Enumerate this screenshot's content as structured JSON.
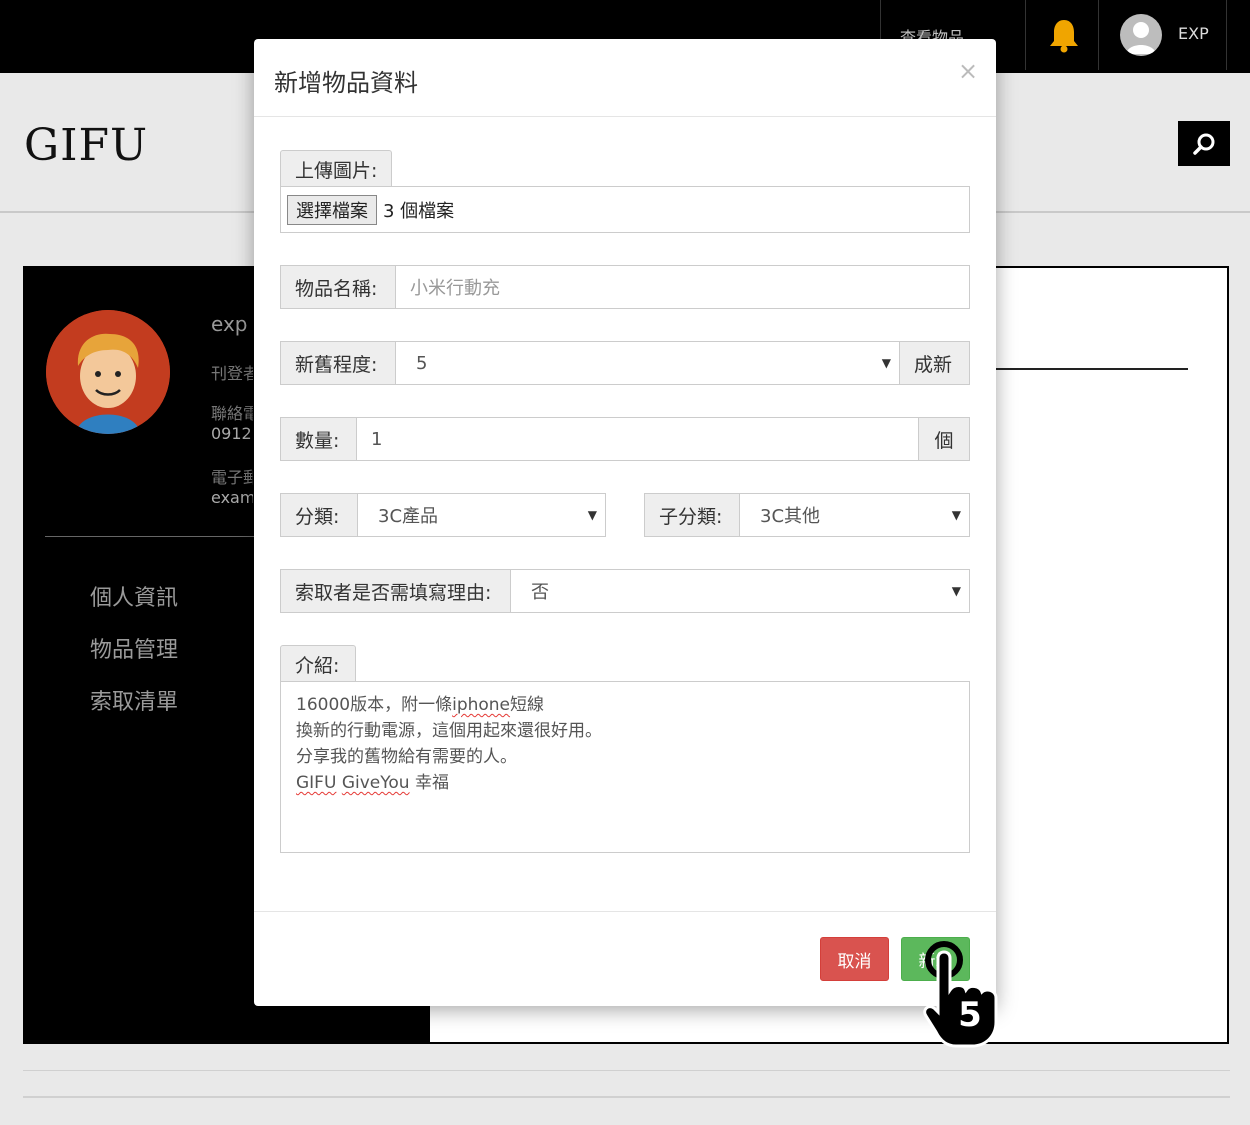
{
  "topbar": {
    "view_items": "查看物品",
    "user_name": "EXP"
  },
  "brand": {
    "logo": "GIFU"
  },
  "profile": {
    "name": "exp",
    "line1": "刊登者",
    "line2": "聯絡電話",
    "line3": "0912",
    "line4": "電子郵件",
    "line5": "exam"
  },
  "sidebar": {
    "items": [
      {
        "label": "個人資訊"
      },
      {
        "label": "物品管理"
      },
      {
        "label": "索取清單"
      }
    ]
  },
  "modal": {
    "title": "新增物品資料",
    "close": "×",
    "upload": {
      "label": "上傳圖片:",
      "button": "選擇檔案",
      "status": "3 個檔案"
    },
    "item_name": {
      "label": "物品名稱:",
      "placeholder": "小米行動充"
    },
    "condition": {
      "label": "新舊程度:",
      "value": "5",
      "suffix": "成新"
    },
    "quantity": {
      "label": "數量:",
      "value": "1",
      "suffix": "個"
    },
    "category": {
      "label": "分類:",
      "value": "3C產品"
    },
    "subcategory": {
      "label": "子分類:",
      "value": "3C其他"
    },
    "reason": {
      "label": "索取者是否需填寫理由:",
      "value": "否"
    },
    "intro": {
      "label": "介紹:",
      "line1_a": "16000版本，附一條",
      "line1_b": "iphone",
      "line1_c": "短線",
      "line2": "換新的行動電源，這個用起來還很好用。",
      "line3": "分享我的舊物給有需要的人。",
      "line4_a": "GIFU",
      "line4_b": "GiveYou",
      "line4_c": " 幸福"
    },
    "cancel_label": "取消",
    "add_label": "新增"
  },
  "annotation": {
    "step": "5"
  },
  "colors": {
    "cancel": "#d9534f",
    "add": "#5cb85c",
    "bell": "#f0a500"
  }
}
